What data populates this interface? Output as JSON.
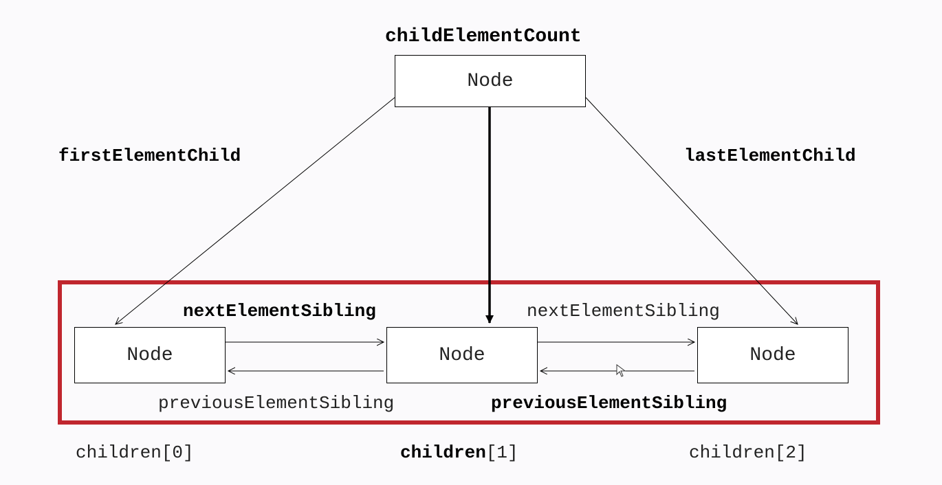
{
  "title": "childElementCount",
  "parent": {
    "label": "Node"
  },
  "children": [
    {
      "label": "Node",
      "caption": "children[0]"
    },
    {
      "label": "Node",
      "caption_prefix": "children",
      "caption_index": "[1]"
    },
    {
      "label": "Node",
      "caption": "children[2]"
    }
  ],
  "labels": {
    "firstElementChild": "firstElementChild",
    "lastElementChild": "lastElementChild",
    "nextSiblingLeft": "nextElementSibling",
    "nextSiblingRight": "nextElementSibling",
    "prevSiblingLeft": "previousElementSibling",
    "prevSiblingRight": "previousElementSibling"
  }
}
